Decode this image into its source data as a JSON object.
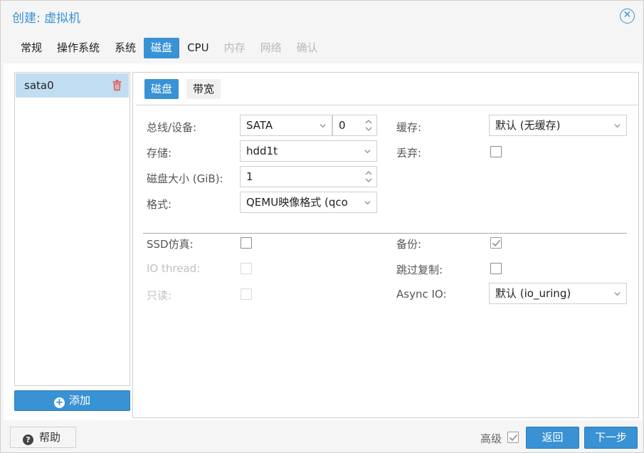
{
  "window": {
    "title": "创建: 虚拟机"
  },
  "tabs": [
    "常规",
    "操作系统",
    "系统",
    "磁盘",
    "CPU",
    "内存",
    "网络",
    "确认"
  ],
  "disk_list": {
    "items": [
      "sata0"
    ],
    "add_label": "添加"
  },
  "subtabs": [
    "磁盘",
    "带宽"
  ],
  "form": {
    "bus_label": "总线/设备:",
    "bus_value": "SATA",
    "device_value": "0",
    "storage_label": "存储:",
    "storage_value": "hdd1t",
    "size_label": "磁盘大小 (GiB):",
    "size_value": "1",
    "format_label": "格式:",
    "format_value": "QEMU映像格式 (qco",
    "cache_label": "缓存:",
    "cache_value": "默认 (无缓存)",
    "discard_label": "丢弃:",
    "discard_checked": false,
    "ssd_label": "SSD仿真:",
    "ssd_checked": false,
    "iothread_label": "IO thread:",
    "iothread_checked": false,
    "readonly_label": "只读:",
    "readonly_checked": false,
    "backup_label": "备份:",
    "backup_checked": true,
    "skip_replication_label": "跳过复制:",
    "skip_replication_checked": false,
    "async_io_label": "Async IO:",
    "async_io_value": "默认 (io_uring)"
  },
  "footer": {
    "help_label": "帮助",
    "advanced_label": "高级",
    "advanced_checked": true,
    "back_label": "返回",
    "next_label": "下一步"
  },
  "colors": {
    "accent": "#3892d4",
    "selected_row": "#c1ddf1",
    "trash": "#e06c6c"
  }
}
